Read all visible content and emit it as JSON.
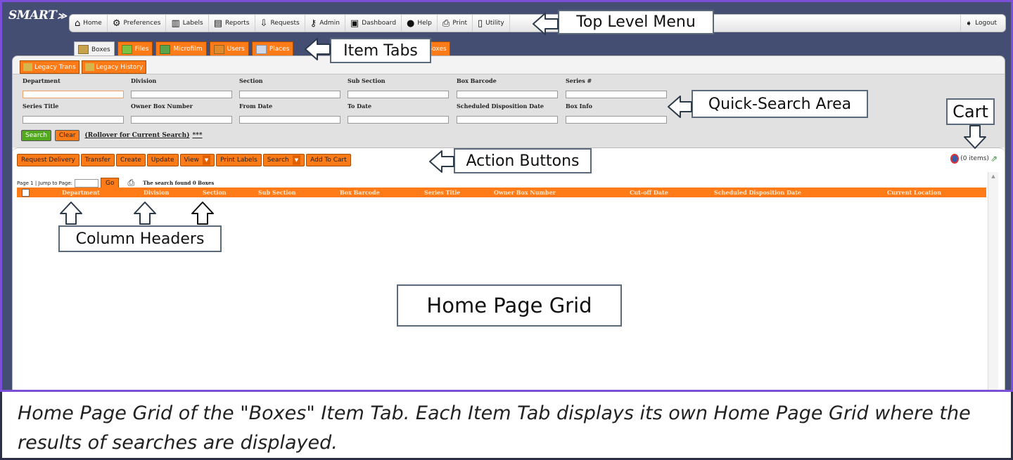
{
  "app": {
    "logo": "SMART",
    "logo_mark": "≫"
  },
  "menu": [
    {
      "icon": "home-icon",
      "glyph": "⌂",
      "label": "Home"
    },
    {
      "icon": "preferences-icon",
      "glyph": "⚙",
      "label": "Preferences"
    },
    {
      "icon": "labels-icon",
      "glyph": "▥",
      "label": "Labels"
    },
    {
      "icon": "reports-icon",
      "glyph": "▤",
      "label": "Reports"
    },
    {
      "icon": "requests-icon",
      "glyph": "⇩",
      "label": "Requests"
    },
    {
      "icon": "admin-icon",
      "glyph": "⚷",
      "label": "Admin"
    },
    {
      "icon": "dashboard-icon",
      "glyph": "▣",
      "label": "Dashboard"
    },
    {
      "icon": "help-icon",
      "glyph": "●",
      "label": "Help"
    },
    {
      "icon": "print-icon",
      "glyph": "⎙",
      "label": "Print"
    },
    {
      "icon": "utility-icon",
      "glyph": "▯",
      "label": "Utility"
    }
  ],
  "logout": {
    "label": "Logout",
    "glyph": "➧"
  },
  "item_tabs": [
    {
      "label": "Boxes",
      "active": true,
      "color": "#c8a24a"
    },
    {
      "label": "Files",
      "active": false,
      "color": "#7cc242"
    },
    {
      "label": "Microfilm",
      "active": false,
      "color": "#5aa34a"
    },
    {
      "label": "Users",
      "active": false,
      "color": "#e08a2a"
    },
    {
      "label": "Places",
      "active": false,
      "color": "#cfd8e8"
    }
  ],
  "item_tab_extra": "Boxes",
  "sub_tabs": [
    "Legacy Trans",
    "Legacy History"
  ],
  "search_fields": {
    "row1": [
      "Department",
      "Division",
      "Section",
      "Sub Section",
      "Box Barcode",
      "Series #"
    ],
    "row2": [
      "Series Title",
      "Owner Box Number",
      "From Date",
      "To Date",
      "Scheduled Disposition Date",
      "Box Info"
    ]
  },
  "search_buttons": {
    "search": "Search",
    "clear": "Clear",
    "rollover": "(Rollover for Current Search)",
    "stars": "***"
  },
  "actions": [
    {
      "label": "Request Delivery",
      "dropdown": false
    },
    {
      "label": "Transfer",
      "dropdown": false
    },
    {
      "label": "Create",
      "dropdown": false
    },
    {
      "label": "Update",
      "dropdown": false
    },
    {
      "label": "View",
      "dropdown": true
    },
    {
      "label": "Print Labels",
      "dropdown": false
    },
    {
      "label": "Search",
      "dropdown": true
    },
    {
      "label": "Add To Cart",
      "dropdown": false
    }
  ],
  "cart": {
    "label": "(0 items)"
  },
  "paging": {
    "page": "Page 1 | Jump to Page:",
    "go": "Go",
    "found": "The search found 0 Boxes"
  },
  "columns": [
    "Department",
    "Division",
    "Section",
    "Sub Section",
    "Box Barcode",
    "Series Title",
    "Owner Box Number",
    "Cut-off Date",
    "Scheduled Disposition Date",
    "Current Location"
  ],
  "annotations": {
    "top_menu": "Top Level Menu",
    "item_tabs": "Item Tabs",
    "quick_search": "Quick-Search Area",
    "cart": "Cart",
    "action_buttons": "Action Buttons",
    "column_headers": "Column Headers",
    "grid": "Home Page Grid"
  },
  "caption": "Home Page Grid of the \"Boxes\" Item Tab. Each Item Tab displays its own Home Page Grid where the results of searches are displayed.",
  "colors": {
    "frame": "#7b4fd8",
    "orange": "#ff7b17",
    "green": "#52a91e",
    "header_bg": "#444d72"
  }
}
